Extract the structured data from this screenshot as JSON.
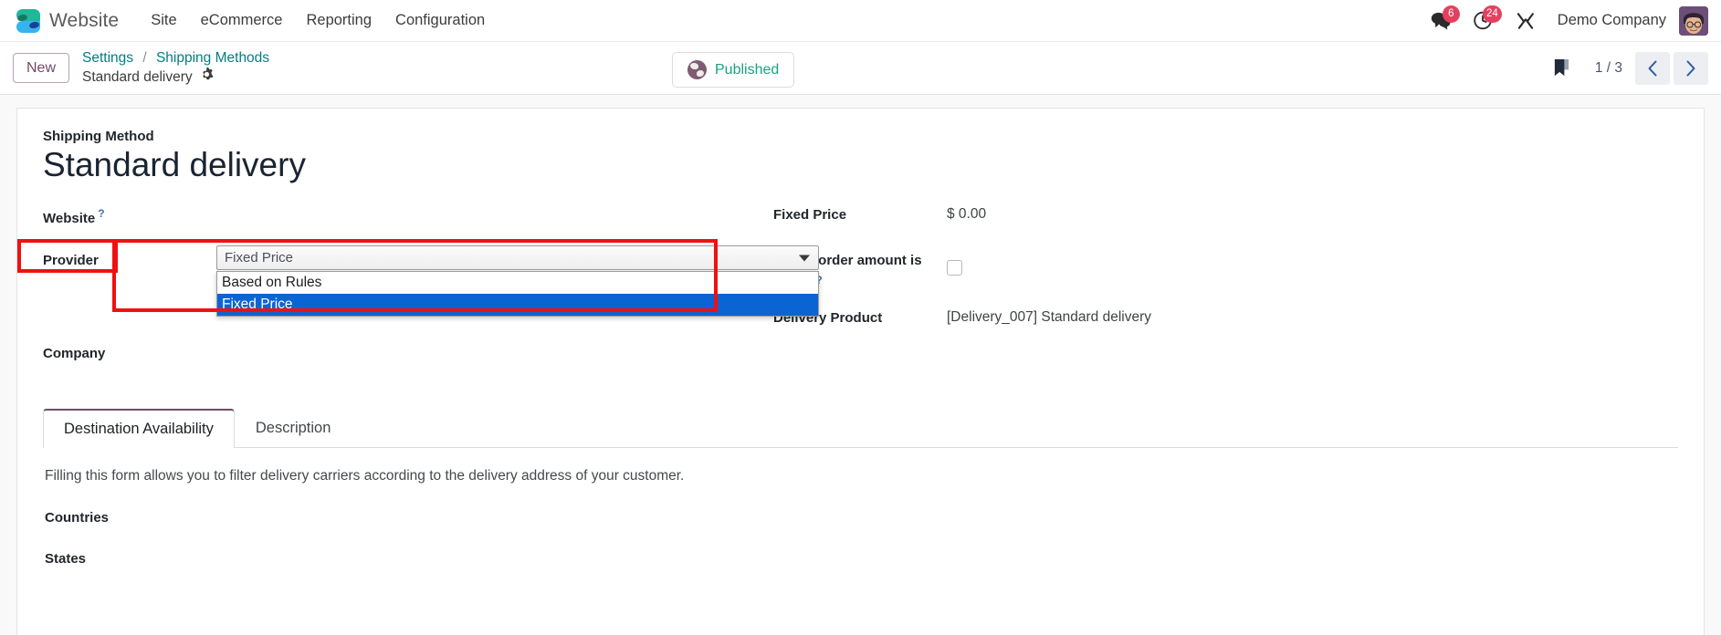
{
  "navbar": {
    "logo_icon": "odoo-logo-icon",
    "app_name": "Website",
    "menus": [
      {
        "label": "Site"
      },
      {
        "label": "eCommerce"
      },
      {
        "label": "Reporting"
      },
      {
        "label": "Configuration"
      }
    ],
    "messages": {
      "icon": "chat-bubbles-icon",
      "count": "6"
    },
    "activities": {
      "icon": "clock-icon",
      "count": "24"
    },
    "tools": {
      "icon": "wrench-screwdriver-icon"
    },
    "company": "Demo Company",
    "avatar_icon": "user-avatar"
  },
  "control_panel": {
    "new_label": "New",
    "breadcrumb": {
      "root": "Settings",
      "separator": "/",
      "section": "Shipping Methods",
      "record": "Standard delivery",
      "gear_icon": "gear-icon"
    },
    "status": {
      "label": "Published",
      "icon": "globe-icon"
    },
    "bookmark_icon": "bookmark-icon",
    "pager": {
      "count": "1 / 3",
      "prev_icon": "chevron-left-icon",
      "next_icon": "chevron-right-icon"
    }
  },
  "form": {
    "model_label": "Shipping Method",
    "title": "Standard delivery",
    "left": {
      "website": {
        "label": "Website",
        "help": "?",
        "value": ""
      },
      "provider": {
        "label": "Provider",
        "selected": "Fixed Price",
        "options": [
          {
            "label": "Based on Rules",
            "selected": false
          },
          {
            "label": "Fixed Price",
            "selected": true
          }
        ],
        "caret_icon": "dropdown-caret-icon"
      },
      "company": {
        "label": "Company",
        "value": ""
      }
    },
    "right": {
      "fixed_price": {
        "label": "Fixed Price",
        "value": "$ 0.00"
      },
      "free_if_above": {
        "label": "Free if order amount is above",
        "help": "?",
        "checked": false
      },
      "delivery_product": {
        "label": "Delivery Product",
        "value": "[Delivery_007] Standard delivery"
      }
    }
  },
  "notebook": {
    "tabs": [
      {
        "label": "Destination Availability",
        "active": true
      },
      {
        "label": "Description",
        "active": false
      }
    ],
    "destination_availability": {
      "help_text": "Filling this form allows you to filter delivery carriers according to the delivery address of your customer.",
      "countries_label": "Countries",
      "states_label": "States"
    }
  },
  "colors": {
    "accent": "#714b67",
    "link": "#017e84",
    "badge": "#e4405f",
    "highlight": "#ef1111",
    "option_selected_bg": "#0b64d4",
    "published_text": "#1aa181"
  }
}
